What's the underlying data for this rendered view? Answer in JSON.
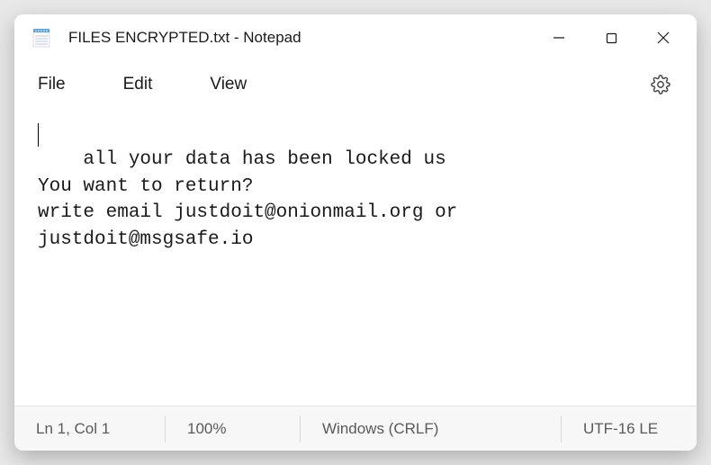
{
  "window": {
    "title": "FILES ENCRYPTED.txt - Notepad"
  },
  "menu": {
    "file": "File",
    "edit": "Edit",
    "view": "View"
  },
  "content": {
    "text": "all your data has been locked us\nYou want to return?\nwrite email justdoit@onionmail.org or justdoit@msgsafe.io"
  },
  "statusbar": {
    "position": "Ln 1, Col 1",
    "zoom": "100%",
    "lineending": "Windows (CRLF)",
    "encoding": "UTF-16 LE"
  }
}
